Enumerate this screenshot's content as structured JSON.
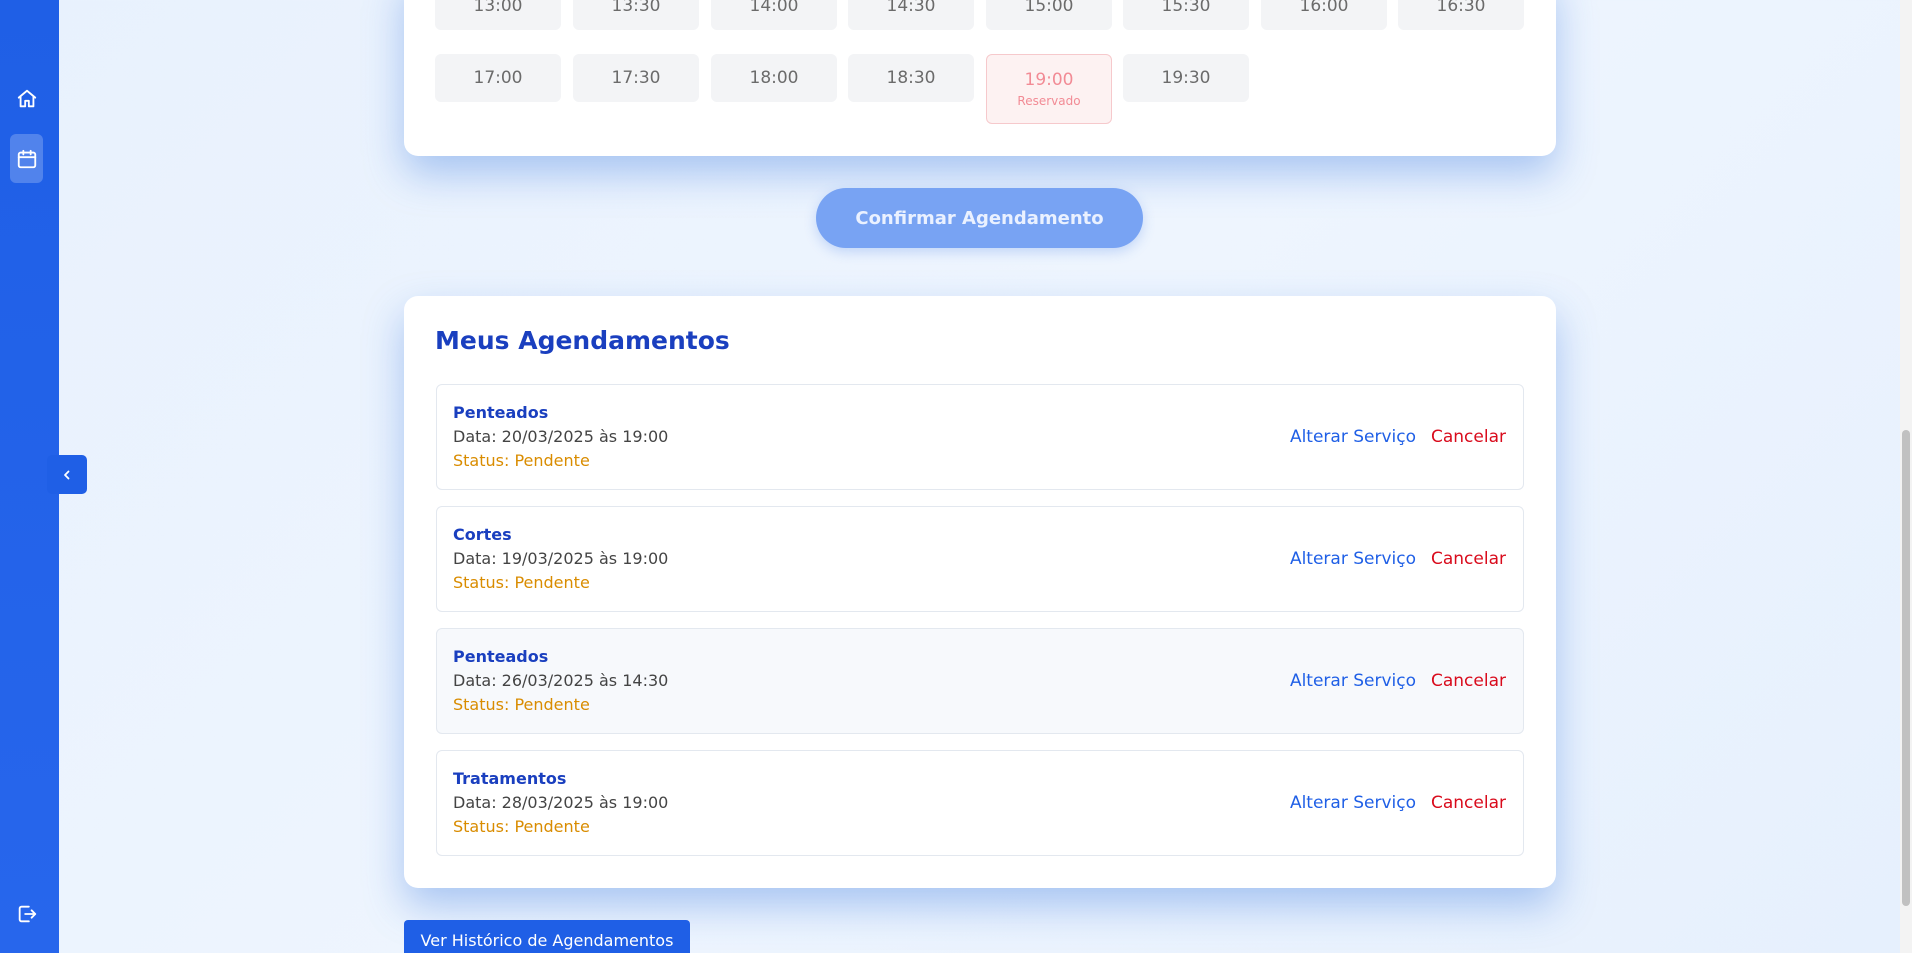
{
  "sidebar": {
    "items": [
      {
        "name": "home",
        "icon": "home-icon"
      },
      {
        "name": "calendar",
        "icon": "calendar-icon",
        "active": true
      },
      {
        "name": "logout",
        "icon": "logout-icon"
      }
    ],
    "collapse_icon": "chevron-left-icon"
  },
  "time_slots": [
    {
      "time": "13:00"
    },
    {
      "time": "13:30"
    },
    {
      "time": "14:00"
    },
    {
      "time": "14:30"
    },
    {
      "time": "15:00"
    },
    {
      "time": "15:30"
    },
    {
      "time": "16:00"
    },
    {
      "time": "16:30"
    },
    {
      "time": "17:00"
    },
    {
      "time": "17:30"
    },
    {
      "time": "18:00"
    },
    {
      "time": "18:30"
    },
    {
      "time": "19:00",
      "status": "Reservado"
    },
    {
      "time": "19:30"
    }
  ],
  "confirm_label": "Confirmar Agendamento",
  "appointments": {
    "title": "Meus Agendamentos",
    "items": [
      {
        "service": "Penteados",
        "date": "Data: 20/03/2025 às 19:00",
        "status": "Status: Pendente",
        "change_label": "Alterar Serviço",
        "cancel_label": "Cancelar"
      },
      {
        "service": "Cortes",
        "date": "Data: 19/03/2025 às 19:00",
        "status": "Status: Pendente",
        "change_label": "Alterar Serviço",
        "cancel_label": "Cancelar"
      },
      {
        "service": "Penteados",
        "date": "Data: 26/03/2025 às 14:30",
        "status": "Status: Pendente",
        "change_label": "Alterar Serviço",
        "cancel_label": "Cancelar"
      },
      {
        "service": "Tratamentos",
        "date": "Data: 28/03/2025 às 19:00",
        "status": "Status: Pendente",
        "change_label": "Alterar Serviço",
        "cancel_label": "Cancelar"
      }
    ]
  },
  "history_label": "Ver Histórico de Agendamentos",
  "colors": {
    "primary": "#1f5fe6",
    "title": "#1a3fbf",
    "pending": "#d98c00",
    "cancel": "#d90b1c",
    "reserved": "#f28b95"
  }
}
